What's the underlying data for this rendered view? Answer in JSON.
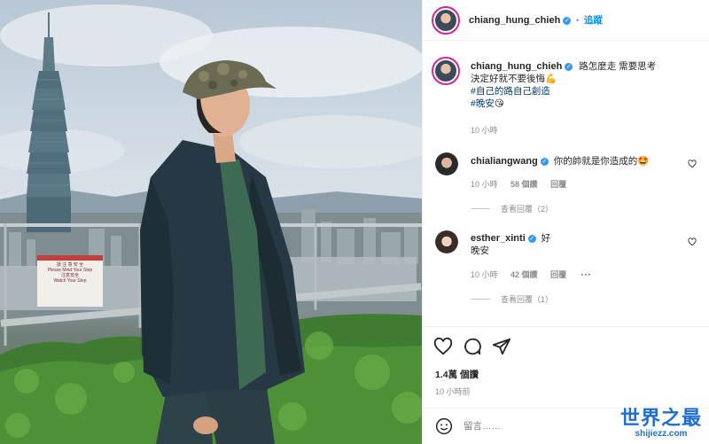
{
  "photo": {
    "sign_lines": [
      "請 注 意 安 全",
      "Please Mind Your Step",
      "注意安全",
      "Watch Your Step"
    ]
  },
  "header": {
    "username": "chiang_hung_chieh",
    "separator": "•",
    "follow_label": "追蹤"
  },
  "caption": {
    "username": "chiang_hung_chieh",
    "line1": "路怎麼走 需要思考",
    "line2": "決定好就不要後悔",
    "line2_emoji": "💪",
    "hashtag1": "#自己的路自己創造",
    "hashtag2": "#晚安",
    "hashtag2_emoji": "😘",
    "time": "10 小時"
  },
  "comments": [
    {
      "username": "chialiangwang",
      "text": "你的帥就是你造成的",
      "emoji": "🤩",
      "time": "10 小時",
      "likes": "58 個讚",
      "reply": "回覆",
      "view_replies": "查看回覆（2）"
    },
    {
      "username": "esther_xinti",
      "text": "好",
      "text2": "晚安",
      "time": "10 小時",
      "likes": "42 個讚",
      "reply": "回覆",
      "view_replies": "查看回覆（1）"
    }
  ],
  "actions": {
    "likes_count": "1.4萬 個讚",
    "post_time": "10 小時前"
  },
  "add_comment": {
    "placeholder": "留言……"
  },
  "watermark": {
    "title": "世界之最",
    "url": "shijiezz.com"
  },
  "colors": {
    "accent_blue": "#0095f6",
    "verified_blue": "#3897f0",
    "story_ring": "#d6249f",
    "muted_text": "#8e8e8e"
  }
}
